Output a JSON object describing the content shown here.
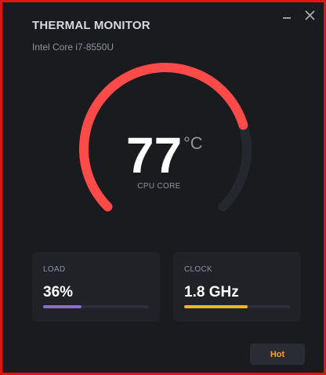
{
  "app": {
    "title": "THERMAL MONITOR",
    "subtitle": "Intel Core i7-8550U"
  },
  "window_controls": {
    "minimize_icon": "minimize-icon",
    "close_icon": "close-icon"
  },
  "gauge": {
    "value": "77",
    "unit": "°C",
    "label": "CPU CORE",
    "fill_fraction": 0.77,
    "fill_color": "#ff4a4a",
    "track_color": "#25272e"
  },
  "cards": {
    "load": {
      "label": "LOAD",
      "value": "36%",
      "fill_fraction": 0.36,
      "bar_color": "#8a6cd8"
    },
    "clock": {
      "label": "CLOCK",
      "value": "1.8 GHz",
      "fill_fraction": 0.6,
      "bar_color": "#f0b323"
    }
  },
  "status": {
    "label": "Hot",
    "color": "#f5a623"
  }
}
